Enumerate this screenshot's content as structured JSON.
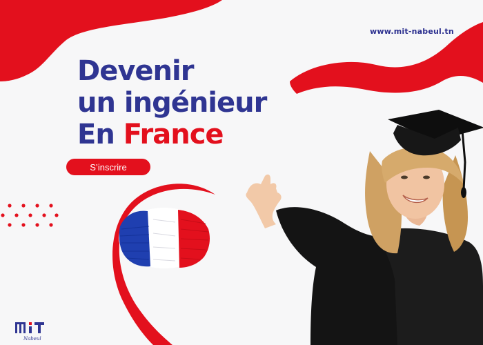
{
  "header": {
    "website": "www.mit-nabeul.tn"
  },
  "headline": {
    "line1": "Devenir",
    "line2": "un ingénieur",
    "line3_prefix": "En",
    "line3_accent": "France"
  },
  "cta": {
    "label": "S’inscrire"
  },
  "logo": {
    "mark": "MIT",
    "sub": "Nabeul"
  },
  "colors": {
    "brand_blue": "#2f3592",
    "brand_red": "#e3101d",
    "background": "#f7f7f8"
  },
  "icons": [
    "france-flag-icon",
    "decorative-dots-icon",
    "mit-logo-icon"
  ]
}
